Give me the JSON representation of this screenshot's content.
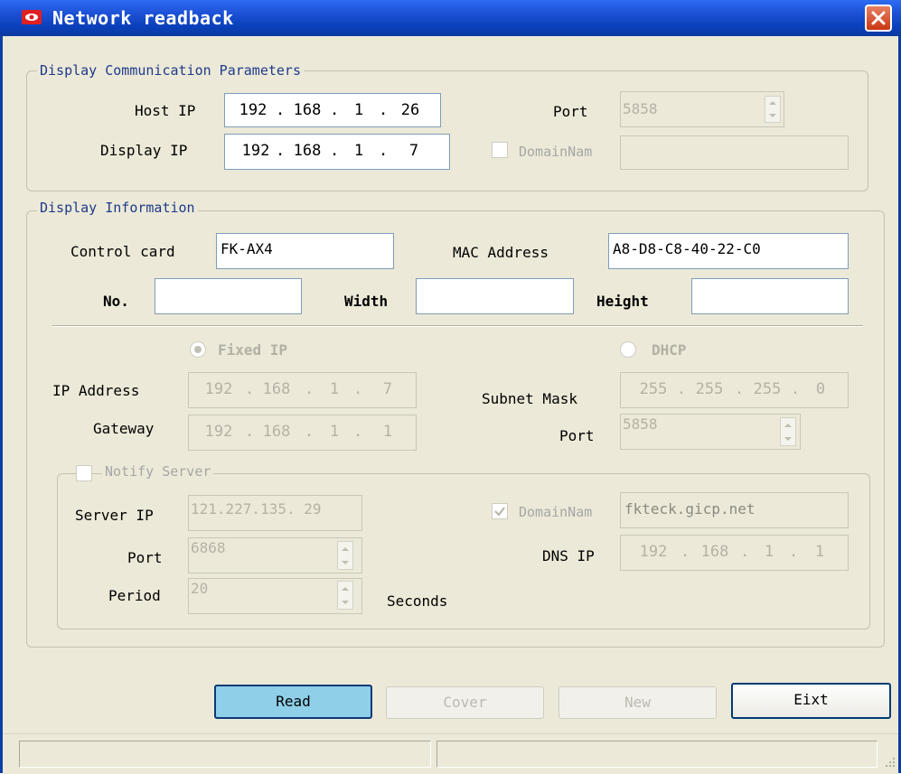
{
  "window": {
    "title": "Network readback",
    "close_glyph": "X"
  },
  "comm_group": {
    "legend": "Display Communication Parameters",
    "host_ip_label": "Host IP",
    "host_ip": [
      "192",
      "168",
      "1",
      "26"
    ],
    "display_ip_label": "Display IP",
    "display_ip": [
      "192",
      "168",
      "1",
      "7"
    ],
    "port_label": "Port",
    "port_value": "5858",
    "domain_label": "DomainNam",
    "domain_value": "",
    "domain_checked": false
  },
  "info_group": {
    "legend": "Display Information",
    "control_card_label": "Control card",
    "control_card_value": "FK-AX4",
    "mac_label": "MAC Address",
    "mac_value": "A8-D8-C8-40-22-C0",
    "no_label": "No.",
    "no_value": "",
    "width_label": "Width",
    "width_value": "",
    "height_label": "Height",
    "height_value": "",
    "fixed_ip_label": "Fixed IP",
    "dhcp_label": "DHCP",
    "ip_mode": "Fixed IP",
    "ip_address_label": "IP Address",
    "ip_address": [
      "192",
      "168",
      "1",
      "7"
    ],
    "subnet_label": "Subnet Mask",
    "subnet": [
      "255",
      "255",
      "255",
      "0"
    ],
    "gateway_label": "Gateway",
    "gateway": [
      "192",
      "168",
      "1",
      "1"
    ],
    "port_label": "Port",
    "port_value": "5858"
  },
  "notify_group": {
    "legend": "Notify Server",
    "notify_checked": false,
    "server_ip_label": "Server IP",
    "server_ip_value": "121.227.135. 29",
    "domain_label": "DomainNam",
    "domain_checked": true,
    "domain_value": "fkteck.gicp.net",
    "port_label": "Port",
    "port_value": "6868",
    "dns_label": "DNS IP",
    "dns_ip": [
      "192",
      "168",
      "1",
      "1"
    ],
    "period_label": "Period",
    "period_value": "20",
    "seconds_label": "Seconds"
  },
  "buttons": {
    "read": "Read",
    "cover": "Cover",
    "new": "New",
    "exit": "Eixt"
  },
  "colors": {
    "title_bar": "#1d52d8",
    "accent_button": "#8fcfe8",
    "selection": "#316ac5",
    "legend_text": "#1e3a8a"
  }
}
